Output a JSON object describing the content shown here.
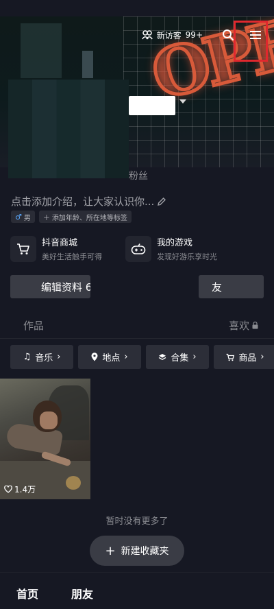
{
  "header": {
    "new_visitors_label": "新访客",
    "new_visitors_count": "99+",
    "profile_fans_label": "粉丝"
  },
  "profile": {
    "intro_placeholder": "点击添加介绍，让大家认识你...",
    "gender_tag": "男",
    "add_tags_label": "添加年龄、所在地等标签"
  },
  "services": [
    {
      "title": "抖音商城",
      "subtitle": "美好生活触手可得",
      "icon": "shopping-cart-icon"
    },
    {
      "title": "我的游戏",
      "subtitle": "发现好游乐享时光",
      "icon": "game-controller-icon"
    }
  ],
  "actions": {
    "edit_profile_label": "编辑资料 6",
    "add_friend_label": "友"
  },
  "tabs": {
    "works": "作品",
    "likes": "喜欢"
  },
  "chips": [
    {
      "label": "音乐",
      "icon": "music-note-icon"
    },
    {
      "label": "地点",
      "icon": "location-pin-icon"
    },
    {
      "label": "合集",
      "icon": "layers-icon"
    },
    {
      "label": "商品",
      "icon": "cart-icon"
    }
  ],
  "videos": [
    {
      "likes": "1.4万"
    }
  ],
  "feed": {
    "no_more_text": "暂时没有更多了",
    "new_folder_label": "新建收藏夹"
  },
  "bottom_nav": {
    "home": "首页",
    "friends": "朋友"
  },
  "colors": {
    "background": "#161823",
    "highlight_box": "#e0282e",
    "neon": "#d85a3a",
    "gender_blue": "#5aa9ff"
  }
}
